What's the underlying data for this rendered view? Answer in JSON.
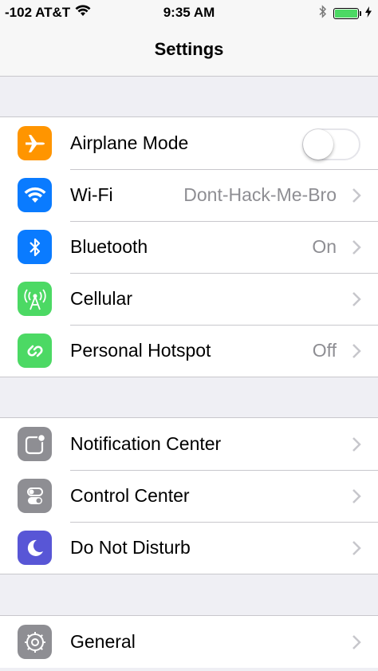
{
  "status": {
    "signal": "-102 AT&T",
    "time": "9:35 AM"
  },
  "nav": {
    "title": "Settings"
  },
  "colors": {
    "airplane": "#ff9500",
    "blue": "#0a7bff",
    "green": "#4cd964",
    "gray": "#8e8e93",
    "purple": "#5856d6"
  },
  "groups": [
    {
      "items": [
        {
          "label": "Airplane Mode",
          "icon": "airplane-icon",
          "toggle": false
        },
        {
          "label": "Wi-Fi",
          "icon": "wifi-icon",
          "value": "Dont-Hack-Me-Bro"
        },
        {
          "label": "Bluetooth",
          "icon": "bluetooth-icon",
          "value": "On"
        },
        {
          "label": "Cellular",
          "icon": "cellular-icon",
          "value": ""
        },
        {
          "label": "Personal Hotspot",
          "icon": "hotspot-icon",
          "value": "Off"
        }
      ]
    },
    {
      "items": [
        {
          "label": "Notification Center",
          "icon": "notification-center-icon"
        },
        {
          "label": "Control Center",
          "icon": "control-center-icon"
        },
        {
          "label": "Do Not Disturb",
          "icon": "moon-icon"
        }
      ]
    },
    {
      "items": [
        {
          "label": "General",
          "icon": "gear-icon"
        }
      ]
    }
  ]
}
